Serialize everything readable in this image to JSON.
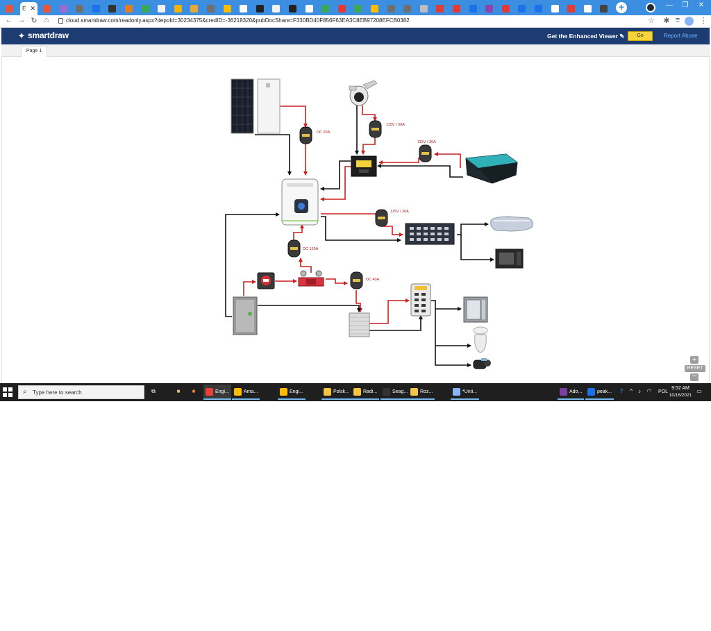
{
  "browser": {
    "active_tab_label": "E",
    "tab_favicon_colors": [
      "#e6553a",
      "#9b6bd3",
      "#6f6f6f",
      "#1a73e8",
      "#333333",
      "#e67c22",
      "#3aa757",
      "#f2f2f2",
      "#f4b400",
      "#e9a93a",
      "#6f6f6f",
      "#fbbc05",
      "#ffffff",
      "#222222",
      "#f2f2f2",
      "#222222",
      "#ffffff",
      "#3aa757",
      "#e53935",
      "#3aa757",
      "#fbbc05",
      "#6f6f6f",
      "#6f6f6f",
      "#bdbdbd",
      "#e53935",
      "#e53935",
      "#1a73e8",
      "#8e44ad",
      "#e53935",
      "#1a73e8",
      "#1a73e8",
      "#ffffff",
      "#e53935",
      "#ffffff",
      "#444444"
    ],
    "url": "cloud.smartdraw.com/readonly.aspx?depoId=30234375&credID=-36218320&pubDocShare=F330BD40F856F63EA3C8EB97208EFCB0382"
  },
  "app": {
    "logo_text": "smartdraw",
    "enhanced_viewer_text": "Get the Enhanced Viewer",
    "go_label": "Go",
    "report_label": "Report Abuse",
    "page_tab_label": "Page 1"
  },
  "diagram": {
    "labels": {
      "dc20": "DC 20A",
      "ac30_top": "115V / 30A",
      "ac30_mid": "115V / 30A",
      "ac30_out": "115V / 30A",
      "dc150": "DC 150A",
      "dc40": "DC 40A"
    },
    "colors": {
      "dc_wire": "#cc1f1f",
      "signal_wire": "#111111"
    }
  },
  "zoom": {
    "plus": "+",
    "reset": "RESET",
    "minus": "−"
  },
  "taskbar": {
    "search_placeholder": "Type here to search",
    "items": [
      {
        "label": "Engi...",
        "color": "#e94235"
      },
      {
        "label": "Ama...",
        "color": "#fbbc05"
      },
      {
        "label": "Engi...",
        "color": "#fbbc05"
      },
      {
        "label": "Polsk...",
        "color": "#f4c542"
      },
      {
        "label": "Radi...",
        "color": "#f4c542"
      },
      {
        "label": "Seag...",
        "color": "#333333"
      },
      {
        "label": "Roz...",
        "color": "#f4c542"
      },
      {
        "label": "*Unti...",
        "color": "#8ab4f8"
      },
      {
        "label": "Ado...",
        "color": "#7b3fa0"
      },
      {
        "label": "peak...",
        "color": "#1a73e8"
      }
    ],
    "tray_lang": "POL",
    "clock_time": "9:52 AM",
    "clock_date": "10/16/2021"
  }
}
